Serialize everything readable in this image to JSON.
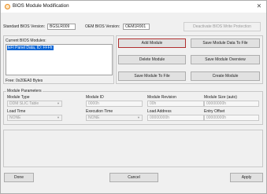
{
  "window": {
    "title": "BIOS Module Modification",
    "close_glyph": "✕"
  },
  "header": {
    "standard_bios_label": "Standard BIOS Version:",
    "standard_bios_value": "BGSLR009",
    "oem_bios_label": "OEM BIOS Version:",
    "oem_bios_value": "OEM1R001",
    "deactivate_label": "Deactivate BIOS Write Protection"
  },
  "modules": {
    "title": "Current BIOS Modules:",
    "items": [
      "EFI Panel Data, ID: FFFh"
    ],
    "free_text": "Free: 0x20EA0 Bytes"
  },
  "actions": {
    "add_module": "Add Module",
    "save_data_to_file": "Save Module Data To File",
    "delete_module": "Delete Module",
    "save_overview": "Save Module Overview",
    "save_module_to_file": "Save Module To File",
    "create_module": "Create Module"
  },
  "params": {
    "title": "Module Parameters",
    "module_type_label": "Module Type",
    "module_type_value": "DDM SLIC Table",
    "module_id_label": "Module ID",
    "module_id_value": "0000h",
    "module_revision_label": "Module Revision",
    "module_revision_value": "00h",
    "module_size_label": "Module Size (auto)",
    "module_size_value": "00000000h",
    "load_time_label": "Load Time",
    "load_time_value": "NONE",
    "execution_time_label": "Execution Time",
    "execution_time_value": "NONE",
    "load_address_label": "Load Address",
    "load_address_value": "00000000h",
    "entry_offset_label": "Entry Offset",
    "entry_offset_value": "00000000h",
    "dropdown_arrow": "▼"
  },
  "footer": {
    "done": "Done",
    "cancel": "Cancel",
    "apply": "Apply"
  },
  "colors": {
    "focus_border": "#b03030",
    "selection": "#0a64d4",
    "icon_accent": "#e8891b"
  },
  "icons": {
    "app": "orange-ring-icon"
  }
}
